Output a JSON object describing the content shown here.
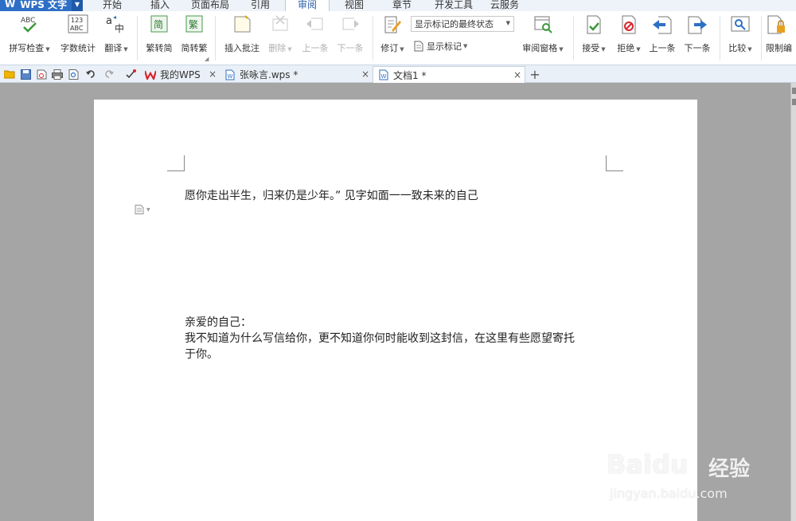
{
  "app": {
    "title": "WPS 文字"
  },
  "menu": {
    "items": [
      {
        "label": "开始"
      },
      {
        "label": "插入"
      },
      {
        "label": "页面布局"
      },
      {
        "label": "引用"
      },
      {
        "label": "审阅"
      },
      {
        "label": "视图"
      },
      {
        "label": "章节"
      },
      {
        "label": "开发工具"
      },
      {
        "label": "云服务"
      }
    ],
    "active_index": 4
  },
  "ribbon": {
    "spell_check": "拼写检查",
    "word_count": "字数统计",
    "translate": "翻译",
    "trad_to_simp": "繁转简",
    "simp_to_trad": "简转繁",
    "insert_comment": "插入批注",
    "delete": "删除",
    "prev": "上一条",
    "next": "下一条",
    "revise": "修订",
    "show_markup_select": "显示标记的最终状态",
    "show_markup": "显示标记",
    "review_pane": "审阅窗格",
    "accept": "接受",
    "reject": "拒绝",
    "prev_change": "上一条",
    "next_change": "下一条",
    "compare": "比较",
    "restrict": "限制编"
  },
  "tabs": [
    {
      "label": "我的WPS"
    },
    {
      "label": "张咏言.wps *"
    },
    {
      "label": "文档1 *"
    }
  ],
  "document": {
    "line1": "愿你走出半生，归来仍是少年。” 见字如面一一致未来的自己",
    "line2": "亲爱的自己：",
    "line3": "我不知道为什么写信给你，更不知道你何时能收到这封信，在这里有些愿望寄托",
    "line4": "于你。"
  },
  "watermark": {
    "brand": "Baidu",
    "cn": "经验",
    "url": "jingyan.baidu.com"
  },
  "colors": {
    "accent": "#2d6fc6",
    "workspace": "#a5a5a5",
    "wps_red": "#d9232d"
  }
}
